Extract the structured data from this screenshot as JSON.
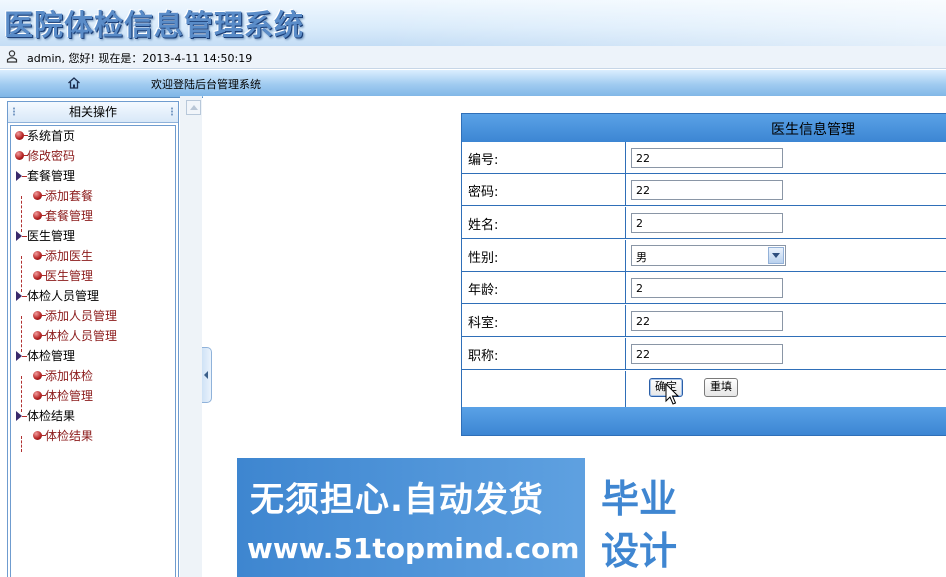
{
  "header": {
    "title": "医院体检信息管理系统"
  },
  "userbar": {
    "text": "admin, 您好! 现在是：2013-4-11 14:50:19"
  },
  "navbar": {
    "welcome": "欢迎登陆后台管理系统"
  },
  "sidebar": {
    "title": "相关操作",
    "items": [
      {
        "label": "系统首页",
        "kind": "top-leaf"
      },
      {
        "label": "修改密码",
        "kind": "top-leaf-red"
      },
      {
        "label": "套餐管理",
        "kind": "folder"
      },
      {
        "label": "添加套餐",
        "kind": "leaf"
      },
      {
        "label": "套餐管理",
        "kind": "leaf"
      },
      {
        "label": "医生管理",
        "kind": "folder"
      },
      {
        "label": "添加医生",
        "kind": "leaf"
      },
      {
        "label": "医生管理",
        "kind": "leaf"
      },
      {
        "label": "体检人员管理",
        "kind": "folder"
      },
      {
        "label": "添加人员管理",
        "kind": "leaf"
      },
      {
        "label": "体检人员管理",
        "kind": "leaf"
      },
      {
        "label": "体检管理",
        "kind": "folder"
      },
      {
        "label": "添加体检",
        "kind": "leaf"
      },
      {
        "label": "体检管理",
        "kind": "leaf"
      },
      {
        "label": "体检结果",
        "kind": "folder"
      },
      {
        "label": "体检结果",
        "kind": "leaf"
      }
    ]
  },
  "form": {
    "title": "医生信息管理",
    "fields": [
      {
        "label": "编号:",
        "value": "22"
      },
      {
        "label": "密码:",
        "value": "22"
      },
      {
        "label": "姓名:",
        "value": "2"
      },
      {
        "label": "性别:",
        "value": "男",
        "type": "select"
      },
      {
        "label": "年龄:",
        "value": "2"
      },
      {
        "label": "科室:",
        "value": "22"
      },
      {
        "label": "职称:",
        "value": "22"
      }
    ],
    "submit_label": "确定",
    "reset_label": "重填"
  },
  "watermark": {
    "line1": "无须担心.自动发货",
    "line2": "www.51topmind.com",
    "right_line1": "毕业",
    "right_line2": "设计"
  },
  "icons": {
    "user": "user-icon",
    "home": "home-icon"
  },
  "colors": {
    "accent": "#3c86d3",
    "tree_link": "#8b1a1a"
  }
}
